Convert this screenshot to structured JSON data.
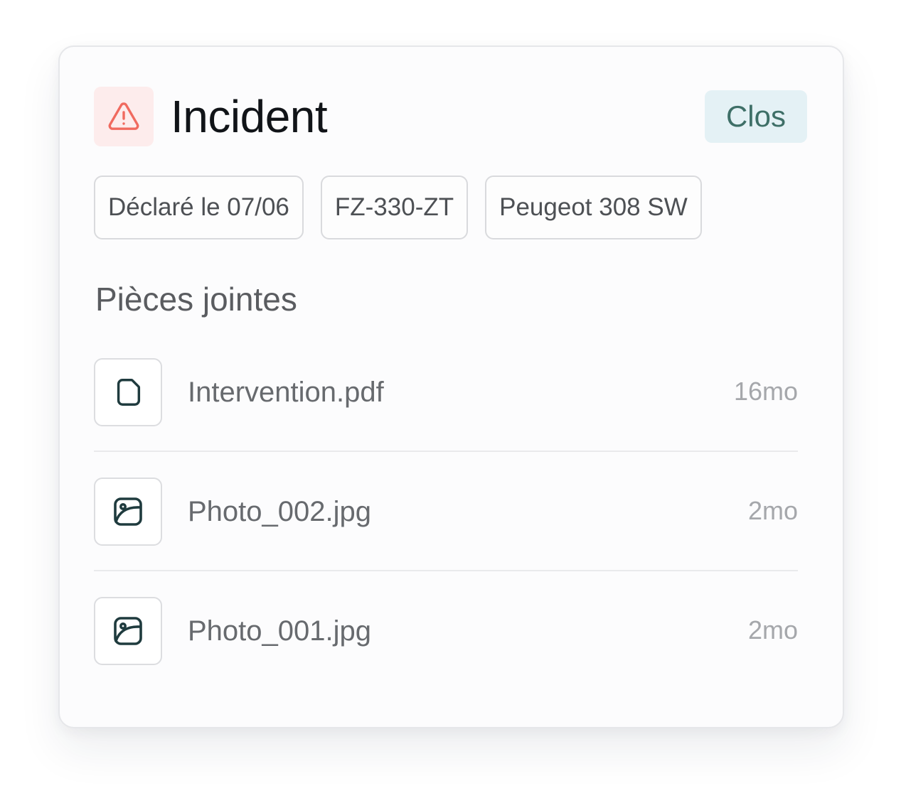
{
  "incident": {
    "title": "Incident",
    "status": "Clos",
    "icon": "alert-triangle-icon"
  },
  "chips": [
    {
      "label": "Déclaré le 07/06"
    },
    {
      "label": "FZ-330-ZT"
    },
    {
      "label": "Peugeot 308 SW"
    }
  ],
  "attachments": {
    "title": "Pièces jointes",
    "items": [
      {
        "name": "Intervention.pdf",
        "age": "16mo",
        "icon": "file-icon"
      },
      {
        "name": "Photo_002.jpg",
        "age": "2mo",
        "icon": "image-icon"
      },
      {
        "name": "Photo_001.jpg",
        "age": "2mo",
        "icon": "image-icon"
      }
    ]
  },
  "colors": {
    "alert": "#f06a5f",
    "alert_bg": "#fdecec",
    "status_text": "#3e6f67",
    "status_bg": "#e4f1f5",
    "icon_stroke": "#1f3b3e"
  }
}
